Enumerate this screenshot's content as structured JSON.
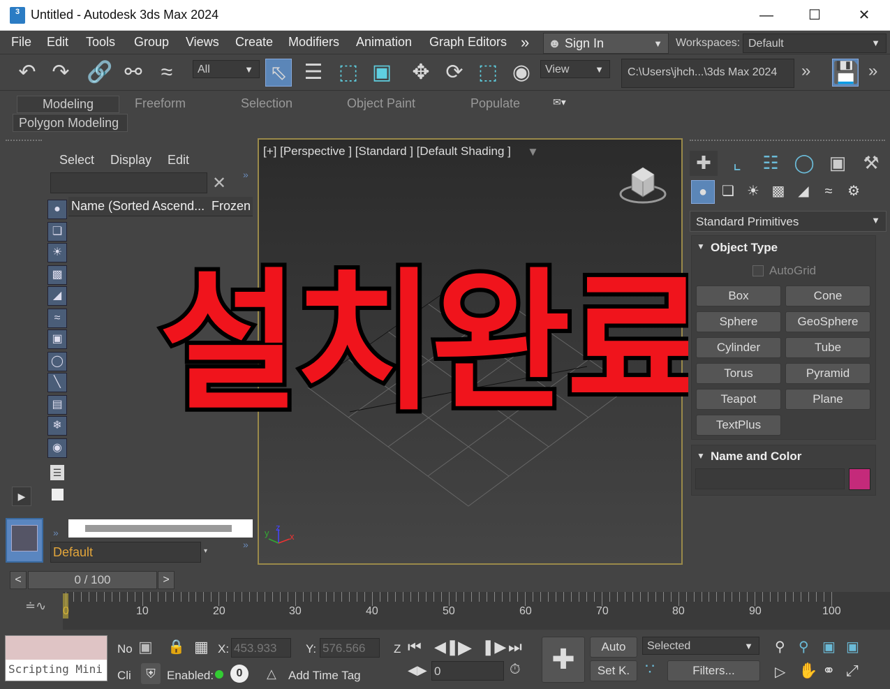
{
  "window": {
    "title": "Untitled - Autodesk 3ds Max 2024",
    "icon_text": "3"
  },
  "menu": [
    "File",
    "Edit",
    "Tools",
    "Group",
    "Views",
    "Create",
    "Modifiers",
    "Animation",
    "Graph Editors"
  ],
  "menu_more": "»",
  "signin": {
    "label": "Sign In"
  },
  "workspaces": {
    "label": "Workspaces:",
    "value": "Default"
  },
  "toolbar": {
    "selection_filter": "All",
    "ref_coord": "View",
    "path": "C:\\Users\\jhch...\\3ds Max 2024",
    "more": "»"
  },
  "ribbon": {
    "tabs": [
      "Modeling",
      "Freeform",
      "Selection",
      "Object Paint",
      "Populate"
    ],
    "sub": "Polygon Modeling"
  },
  "scene_explorer": {
    "tabs": [
      "Select",
      "Display",
      "Edit"
    ],
    "columns": [
      "Name (Sorted Ascend...",
      "Frozen"
    ],
    "layer": "Default"
  },
  "viewport": {
    "label": "[+] [Perspective ] [Standard ] [Default Shading ]",
    "overlay": "설치완료",
    "axis": {
      "x": "x",
      "y": "y",
      "z": "z"
    }
  },
  "command_panel": {
    "category": "Standard Primitives",
    "object_type_title": "Object Type",
    "autogrid": "AutoGrid",
    "buttons": [
      "Box",
      "Cone",
      "Sphere",
      "GeoSphere",
      "Cylinder",
      "Tube",
      "Torus",
      "Pyramid",
      "Teapot",
      "Plane",
      "TextPlus"
    ],
    "name_color_title": "Name and Color",
    "color": "#c42a7a"
  },
  "timeline": {
    "frame": "0 / 100",
    "prev": "<",
    "next": ">",
    "ticks": [
      "0",
      "10",
      "20",
      "30",
      "40",
      "50",
      "60",
      "70",
      "80",
      "90",
      "100"
    ]
  },
  "status": {
    "script": "Scripting Mini",
    "no": "No",
    "cli": "Cli",
    "x_label": "X:",
    "x_value": "453.933",
    "y_label": "Y:",
    "y_value": "576.566",
    "z_label": "Z",
    "enabled": "Enabled:",
    "enabled_count": "0",
    "add_time_tag": "Add Time Tag",
    "auto": "Auto",
    "set_key": "Set K.",
    "key_filter": "Selected",
    "filters": "Filters...",
    "frame_value": "0"
  }
}
